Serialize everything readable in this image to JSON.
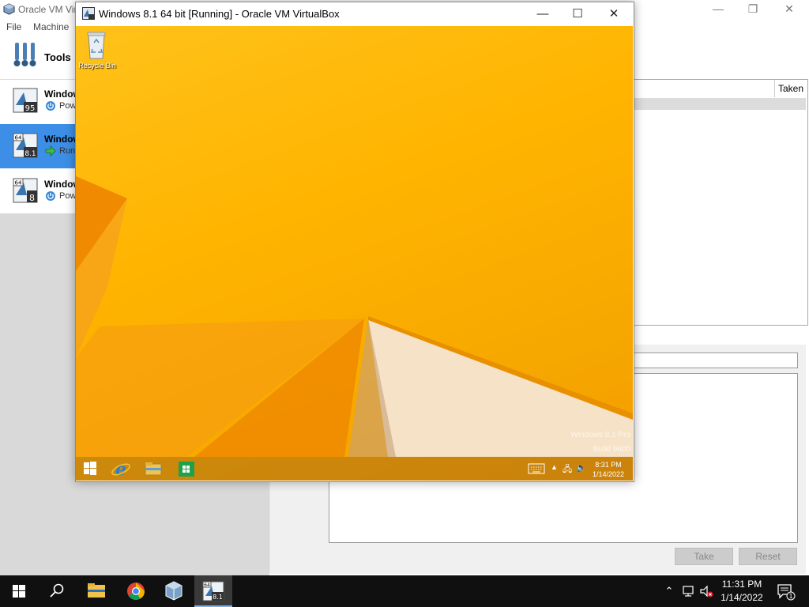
{
  "manager": {
    "title": "Oracle VM Vir",
    "menu": [
      "File",
      "Machine"
    ],
    "tools_label": "Tools",
    "vms": [
      {
        "name": "Window",
        "state": "Pow",
        "badge": "95"
      },
      {
        "name": "Window",
        "state": "Runn",
        "badge": "8.1",
        "arch": "64"
      },
      {
        "name": "Window",
        "state": "Pow",
        "badge": "8",
        "arch": "64"
      }
    ],
    "snapshot_header_taken": "Taken",
    "buttons": {
      "take": "Take",
      "reset": "Reset"
    }
  },
  "vm_window": {
    "title": "Windows 8.1 64 bit [Running] - Oracle VM VirtualBox",
    "controls": {
      "minimize": "—",
      "maximize": "☐",
      "close": "✕"
    }
  },
  "guest": {
    "recycle_bin_label": "Recycle Bin",
    "watermark_line1": "Windows 8.1 Pro",
    "watermark_line2": "Build 9600",
    "time": "8:31 PM",
    "date": "1/14/2022"
  },
  "host_taskbar": {
    "time": "11:31 PM",
    "date": "1/14/2022",
    "notification_count": "1"
  },
  "colors": {
    "selection_blue": "#3d8ee6",
    "desktop_orange": "#ffb400",
    "taskbar_dark": "#101010"
  }
}
